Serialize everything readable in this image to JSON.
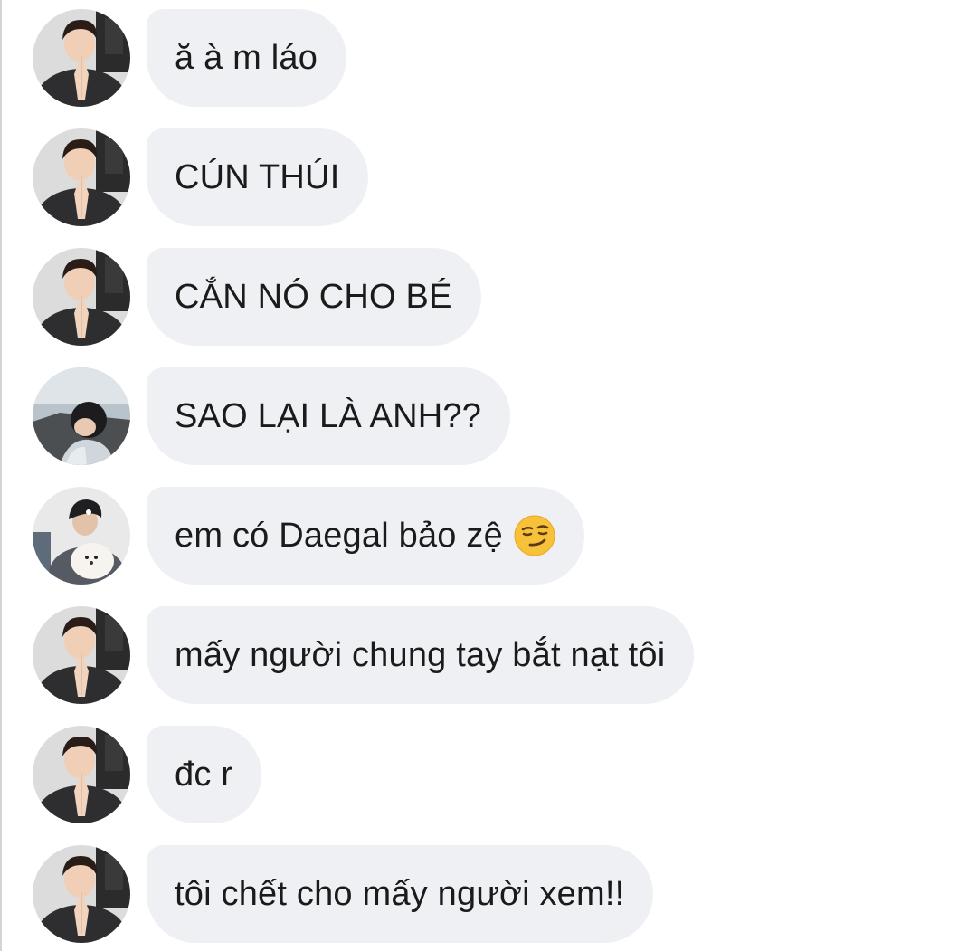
{
  "messages": [
    {
      "avatar": "avatar-boy-praying",
      "text": "ă à m láo"
    },
    {
      "avatar": "avatar-boy-praying",
      "text": "CÚN THÚI"
    },
    {
      "avatar": "avatar-boy-praying",
      "text": "CẮN NÓ CHO BÉ"
    },
    {
      "avatar": "avatar-man-sky",
      "text": "SAO LẠI LÀ ANH??"
    },
    {
      "avatar": "avatar-man-dog",
      "text": "em có Daegal bảo zệ",
      "emoji": "smirk-emoji"
    },
    {
      "avatar": "avatar-boy-praying",
      "text": "mấy người chung tay bắt nạt tôi"
    },
    {
      "avatar": "avatar-boy-praying",
      "text": "đc r"
    },
    {
      "avatar": "avatar-boy-praying",
      "text": "tôi chết cho mấy người xem!!"
    }
  ],
  "colors": {
    "bubble": "#eef0f3",
    "text": "#1b1b1b",
    "background": "#ffffff"
  }
}
